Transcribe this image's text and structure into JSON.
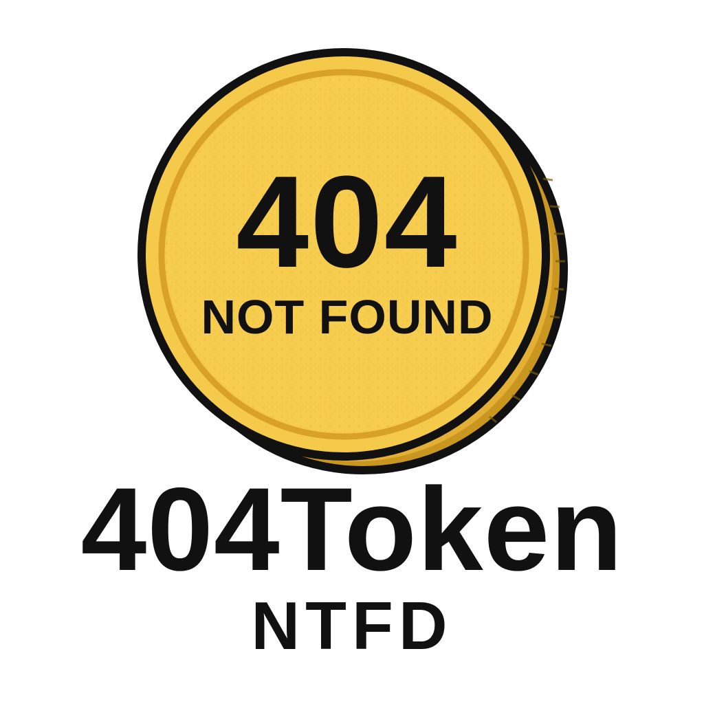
{
  "coin": {
    "code": "404",
    "message": "NOT FOUND",
    "colors": {
      "face": "#f5c94a",
      "rim": "#e0ac2a",
      "edge": "#c9961f",
      "outline": "#111111"
    }
  },
  "brand": {
    "name": "404Token",
    "ticker": "NTFD"
  }
}
